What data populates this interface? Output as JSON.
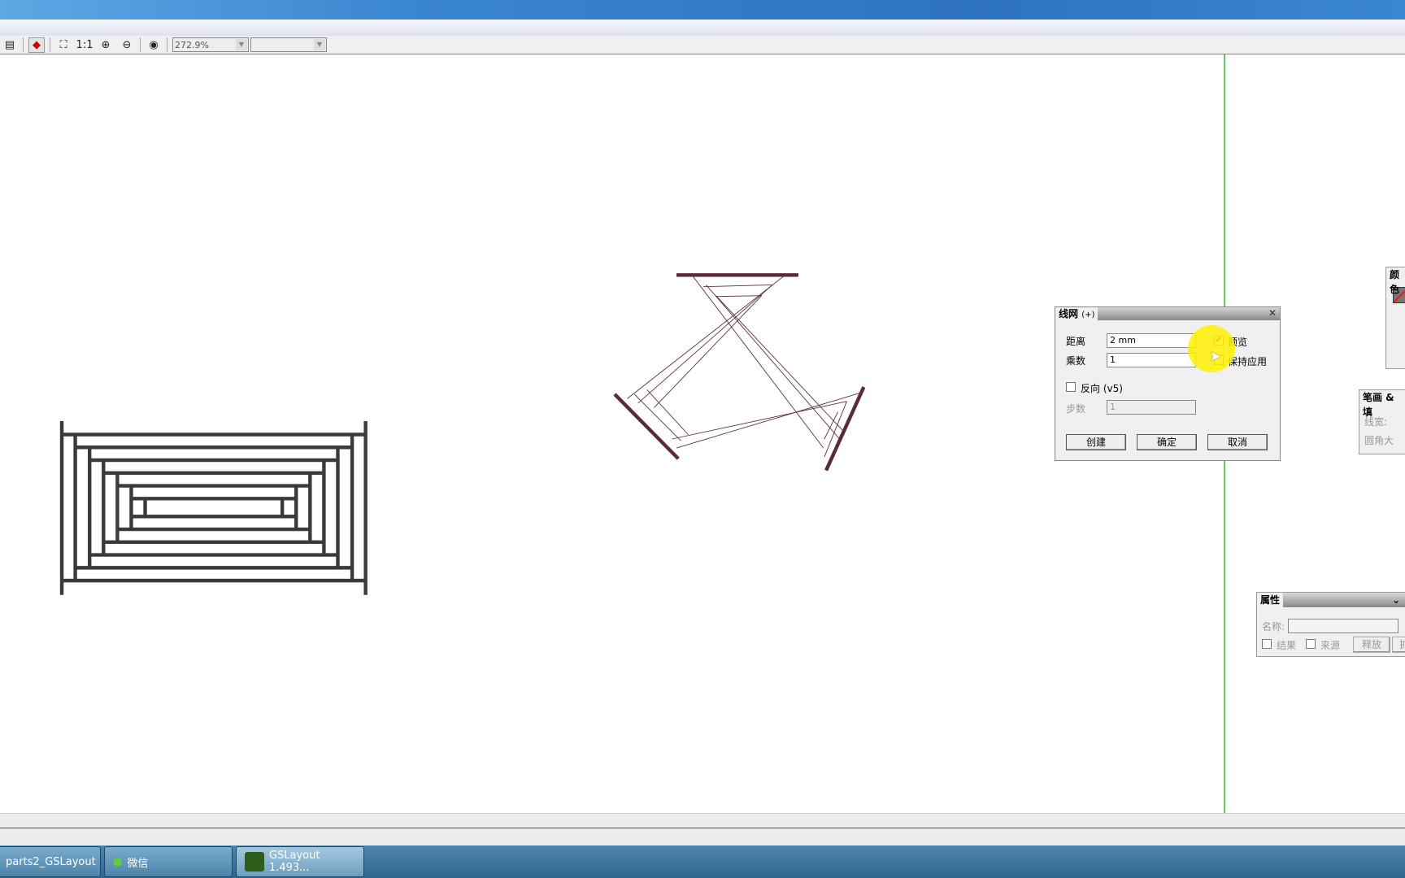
{
  "toolbar": {
    "zoom_value": "272.9%",
    "second_combo": "",
    "one_to_one": "1:1"
  },
  "dialog": {
    "title": "线网",
    "title_suffix": "(+)",
    "distance_label": "距离",
    "distance_value": "2 mm",
    "multiplier_label": "乘数",
    "multiplier_value": "1",
    "preview_label": "预览",
    "preview_checked": true,
    "keep_apply_label": "保持应用",
    "reverse_label": "反向 (v5)",
    "steps_label": "步数",
    "steps_value": "1",
    "create_button": "创建",
    "ok_button": "确定",
    "cancel_button": "取消"
  },
  "panels": {
    "color_title": "颜色",
    "stroke_title": "笔画 & 填",
    "line_width_label": "线宽:",
    "corner_label": "圆角大",
    "props_title": "属性",
    "name_label": "名称:",
    "result_label": "结果",
    "source_label": "来源",
    "release_button": "释放",
    "expand_button": "扩"
  },
  "taskbar": {
    "items": [
      "parts2_GSLayout",
      "微信",
      "GSLayout 1.493..."
    ]
  },
  "colors": {
    "guide": "#5fcf5f",
    "shape": "#5a2a3a",
    "pattern": "#3a3a3e"
  }
}
